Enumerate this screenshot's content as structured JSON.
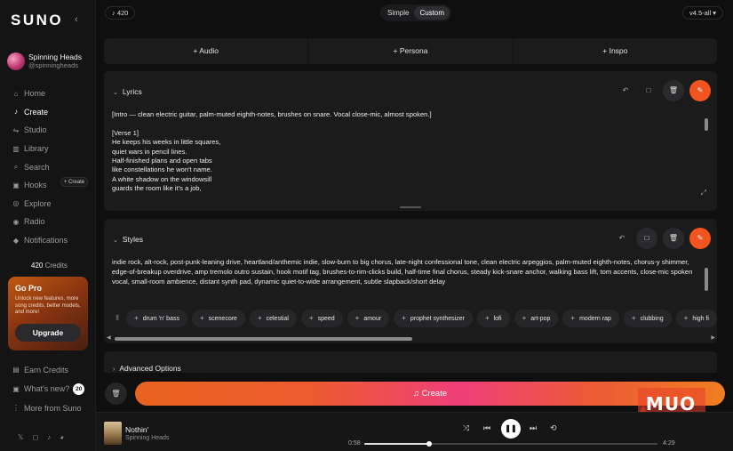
{
  "app": {
    "logo": "SUNO",
    "collapse_icon": "chevron-left-icon"
  },
  "profile": {
    "name": "Spinning Heads",
    "handle": "@spinningheads"
  },
  "nav": [
    {
      "label": "Home",
      "icon": "home-icon",
      "glyph": "⌂",
      "active": false
    },
    {
      "label": "Create",
      "icon": "music-note-icon",
      "glyph": "♪",
      "active": true
    },
    {
      "label": "Studio",
      "icon": "studio-icon",
      "glyph": "⇋",
      "active": false
    },
    {
      "label": "Library",
      "icon": "library-icon",
      "glyph": "▥",
      "active": false
    },
    {
      "label": "Search",
      "icon": "search-icon",
      "glyph": "⌕",
      "active": false
    },
    {
      "label": "Hooks",
      "icon": "hooks-icon",
      "glyph": "▣",
      "active": false
    },
    {
      "label": "Explore",
      "icon": "compass-icon",
      "glyph": "◎",
      "active": false
    },
    {
      "label": "Radio",
      "icon": "radio-icon",
      "glyph": "◉",
      "active": false
    },
    {
      "label": "Notifications",
      "icon": "bell-icon",
      "glyph": "◆",
      "active": false
    }
  ],
  "hooks_create_label": "+ Create",
  "credits": {
    "amount": "420",
    "label": "Credits"
  },
  "gopro": {
    "title": "Go Pro",
    "description": "Unlock new features, more song credits, better models, and more!",
    "button": "Upgrade"
  },
  "bottom_links": [
    {
      "label": "Earn Credits",
      "icon": "earn-icon",
      "glyph": "▤"
    },
    {
      "label": "What's new?",
      "icon": "whats-new-icon",
      "glyph": "▣",
      "badge": "20"
    },
    {
      "label": "More from Suno",
      "icon": "more-icon",
      "glyph": "⋮"
    }
  ],
  "social": [
    {
      "name": "x-icon",
      "glyph": "𝕏"
    },
    {
      "name": "instagram-icon",
      "glyph": "◻"
    },
    {
      "name": "tiktok-icon",
      "glyph": "♪"
    },
    {
      "name": "discord-icon",
      "glyph": "◕"
    }
  ],
  "topbar": {
    "song_count": "420",
    "modes": [
      "Simple",
      "Custom"
    ],
    "active_mode": "Custom",
    "version": "v4.5-all"
  },
  "add_bar": [
    {
      "label": "Audio"
    },
    {
      "label": "Persona"
    },
    {
      "label": "Inspo"
    }
  ],
  "lyrics": {
    "title": "Lyrics",
    "lines": [
      "[Intro — clean electric guitar, palm-muted eighth-notes, brushes on snare. Vocal close-mic, almost spoken.]",
      "",
      "[Verse 1]",
      "He keeps his weeks in little squares,",
      "quiet wars in pencil lines.",
      "Half-finished plans and open tabs",
      "like constellations he won't name.",
      "A white shadow on the windowsill",
      "guards the room like it's a job,"
    ]
  },
  "styles": {
    "title": "Styles",
    "text": "indie rock, alt-rock, post-punk-leaning drive, heartland/anthemic indie, slow-burn to big chorus, late-night confessional tone, clean electric arpeggios, palm-muted eighth-notes, chorus-y shimmer, edge-of-breakup overdrive, amp tremolo outro sustain, hook motif tag, brushes-to-rim-clicks build, half-time final chorus, steady kick-snare anchor, walking bass lift, tom accents, close-mic spoken vocal, small-room ambience, distant synth pad, dynamic quiet-to-wide arrangement, subtle slapback/short delay",
    "tags": [
      "drum 'n' bass",
      "scenecore",
      "celestial",
      "speed",
      "amour",
      "prophet synthesizer",
      "lofi",
      "art-pop",
      "modern rap",
      "clubbing",
      "high fi"
    ]
  },
  "advanced": {
    "title": "Advanced Options"
  },
  "create_button": {
    "label": "Create"
  },
  "player": {
    "track": "Nothin'",
    "artist": "Spinning Heads",
    "current_time": "0:58",
    "duration": "4:29",
    "progress": 0.22
  },
  "watermark": "MUO",
  "colors": {
    "accent": "#f1541e",
    "background": "#0f0f10",
    "panel": "#1b1b1c"
  }
}
